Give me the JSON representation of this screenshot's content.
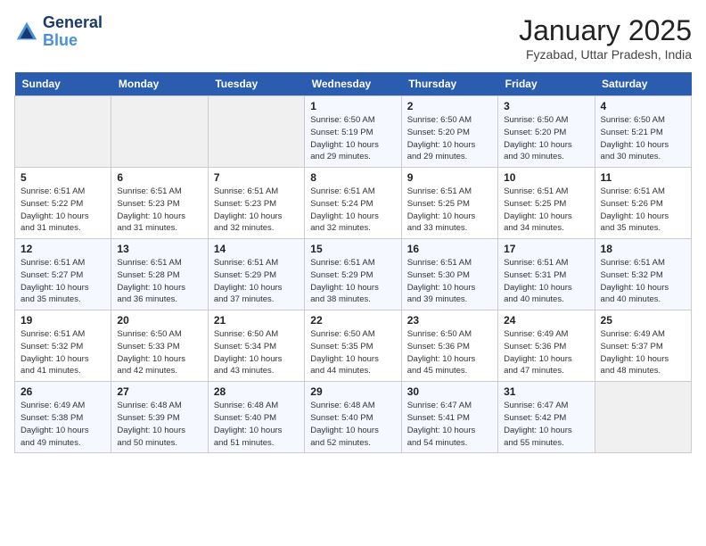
{
  "header": {
    "logo_line1": "General",
    "logo_line2": "Blue",
    "month_title": "January 2025",
    "location": "Fyzabad, Uttar Pradesh, India"
  },
  "days_of_week": [
    "Sunday",
    "Monday",
    "Tuesday",
    "Wednesday",
    "Thursday",
    "Friday",
    "Saturday"
  ],
  "weeks": [
    [
      {
        "day": "",
        "info": ""
      },
      {
        "day": "",
        "info": ""
      },
      {
        "day": "",
        "info": ""
      },
      {
        "day": "1",
        "info": "Sunrise: 6:50 AM\nSunset: 5:19 PM\nDaylight: 10 hours\nand 29 minutes."
      },
      {
        "day": "2",
        "info": "Sunrise: 6:50 AM\nSunset: 5:20 PM\nDaylight: 10 hours\nand 29 minutes."
      },
      {
        "day": "3",
        "info": "Sunrise: 6:50 AM\nSunset: 5:20 PM\nDaylight: 10 hours\nand 30 minutes."
      },
      {
        "day": "4",
        "info": "Sunrise: 6:50 AM\nSunset: 5:21 PM\nDaylight: 10 hours\nand 30 minutes."
      }
    ],
    [
      {
        "day": "5",
        "info": "Sunrise: 6:51 AM\nSunset: 5:22 PM\nDaylight: 10 hours\nand 31 minutes."
      },
      {
        "day": "6",
        "info": "Sunrise: 6:51 AM\nSunset: 5:23 PM\nDaylight: 10 hours\nand 31 minutes."
      },
      {
        "day": "7",
        "info": "Sunrise: 6:51 AM\nSunset: 5:23 PM\nDaylight: 10 hours\nand 32 minutes."
      },
      {
        "day": "8",
        "info": "Sunrise: 6:51 AM\nSunset: 5:24 PM\nDaylight: 10 hours\nand 32 minutes."
      },
      {
        "day": "9",
        "info": "Sunrise: 6:51 AM\nSunset: 5:25 PM\nDaylight: 10 hours\nand 33 minutes."
      },
      {
        "day": "10",
        "info": "Sunrise: 6:51 AM\nSunset: 5:25 PM\nDaylight: 10 hours\nand 34 minutes."
      },
      {
        "day": "11",
        "info": "Sunrise: 6:51 AM\nSunset: 5:26 PM\nDaylight: 10 hours\nand 35 minutes."
      }
    ],
    [
      {
        "day": "12",
        "info": "Sunrise: 6:51 AM\nSunset: 5:27 PM\nDaylight: 10 hours\nand 35 minutes."
      },
      {
        "day": "13",
        "info": "Sunrise: 6:51 AM\nSunset: 5:28 PM\nDaylight: 10 hours\nand 36 minutes."
      },
      {
        "day": "14",
        "info": "Sunrise: 6:51 AM\nSunset: 5:29 PM\nDaylight: 10 hours\nand 37 minutes."
      },
      {
        "day": "15",
        "info": "Sunrise: 6:51 AM\nSunset: 5:29 PM\nDaylight: 10 hours\nand 38 minutes."
      },
      {
        "day": "16",
        "info": "Sunrise: 6:51 AM\nSunset: 5:30 PM\nDaylight: 10 hours\nand 39 minutes."
      },
      {
        "day": "17",
        "info": "Sunrise: 6:51 AM\nSunset: 5:31 PM\nDaylight: 10 hours\nand 40 minutes."
      },
      {
        "day": "18",
        "info": "Sunrise: 6:51 AM\nSunset: 5:32 PM\nDaylight: 10 hours\nand 40 minutes."
      }
    ],
    [
      {
        "day": "19",
        "info": "Sunrise: 6:51 AM\nSunset: 5:32 PM\nDaylight: 10 hours\nand 41 minutes."
      },
      {
        "day": "20",
        "info": "Sunrise: 6:50 AM\nSunset: 5:33 PM\nDaylight: 10 hours\nand 42 minutes."
      },
      {
        "day": "21",
        "info": "Sunrise: 6:50 AM\nSunset: 5:34 PM\nDaylight: 10 hours\nand 43 minutes."
      },
      {
        "day": "22",
        "info": "Sunrise: 6:50 AM\nSunset: 5:35 PM\nDaylight: 10 hours\nand 44 minutes."
      },
      {
        "day": "23",
        "info": "Sunrise: 6:50 AM\nSunset: 5:36 PM\nDaylight: 10 hours\nand 45 minutes."
      },
      {
        "day": "24",
        "info": "Sunrise: 6:49 AM\nSunset: 5:36 PM\nDaylight: 10 hours\nand 47 minutes."
      },
      {
        "day": "25",
        "info": "Sunrise: 6:49 AM\nSunset: 5:37 PM\nDaylight: 10 hours\nand 48 minutes."
      }
    ],
    [
      {
        "day": "26",
        "info": "Sunrise: 6:49 AM\nSunset: 5:38 PM\nDaylight: 10 hours\nand 49 minutes."
      },
      {
        "day": "27",
        "info": "Sunrise: 6:48 AM\nSunset: 5:39 PM\nDaylight: 10 hours\nand 50 minutes."
      },
      {
        "day": "28",
        "info": "Sunrise: 6:48 AM\nSunset: 5:40 PM\nDaylight: 10 hours\nand 51 minutes."
      },
      {
        "day": "29",
        "info": "Sunrise: 6:48 AM\nSunset: 5:40 PM\nDaylight: 10 hours\nand 52 minutes."
      },
      {
        "day": "30",
        "info": "Sunrise: 6:47 AM\nSunset: 5:41 PM\nDaylight: 10 hours\nand 54 minutes."
      },
      {
        "day": "31",
        "info": "Sunrise: 6:47 AM\nSunset: 5:42 PM\nDaylight: 10 hours\nand 55 minutes."
      },
      {
        "day": "",
        "info": ""
      }
    ]
  ]
}
